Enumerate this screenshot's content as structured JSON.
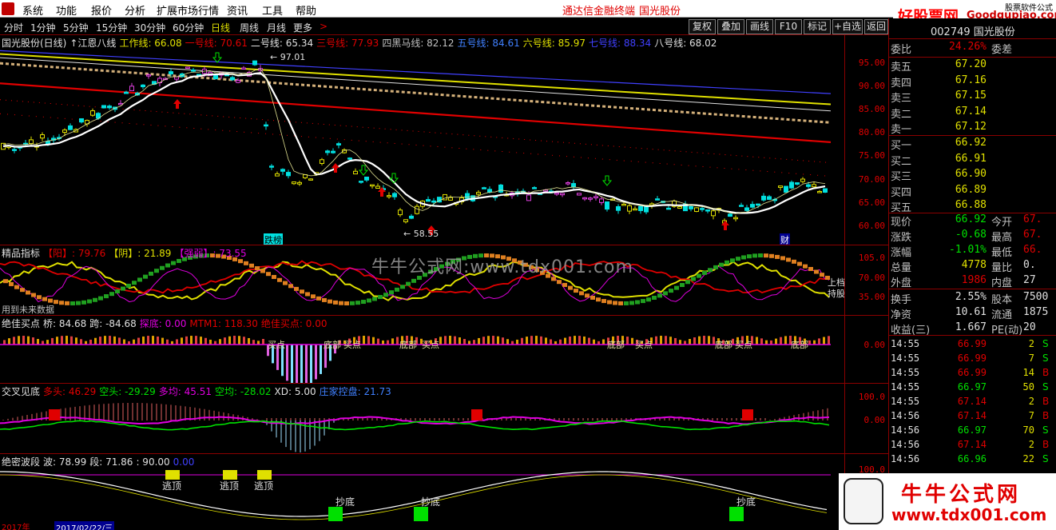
{
  "menu": {
    "items": [
      "系统",
      "功能",
      "报价",
      "分析",
      "扩展市场行情",
      "资讯",
      "工具",
      "帮助"
    ],
    "center_title": "通达信金融终端",
    "stock_title": "国光股份"
  },
  "site_badge": {
    "brand": "好股票网",
    "domain": "Goodgupiao.com",
    "caption": "股票软件公式"
  },
  "periods": {
    "items": [
      "分时",
      "1分钟",
      "5分钟",
      "15分钟",
      "30分钟",
      "60分钟",
      "日线",
      "周线",
      "月线",
      "更多",
      ">"
    ],
    "active": "日线"
  },
  "toolbar_right": [
    "复权",
    "叠加",
    "画线",
    "F10",
    "标记",
    "+自选",
    "返回"
  ],
  "main_chart": {
    "header": [
      {
        "text": "国光股份(日线)",
        "color": "#e0e0e0"
      },
      {
        "text": "↑江恩八线",
        "color": "#e0e0e0"
      },
      {
        "text": "工作线: 66.08",
        "color": "#e0e000"
      },
      {
        "text": "一号线: 70.61",
        "color": "#e00000"
      },
      {
        "text": "二号线: 65.34",
        "color": "#e0e0e0"
      },
      {
        "text": "三号线: 77.93",
        "color": "#e00000"
      },
      {
        "text": "四黑马线: 82.12",
        "color": "#c0c0c0"
      },
      {
        "text": "五号线: 84.61",
        "color": "#4080ff"
      },
      {
        "text": "六号线: 85.97",
        "color": "#e0e000"
      },
      {
        "text": "七号线: 88.34",
        "color": "#4040ff"
      },
      {
        "text": "八号线: 68.02",
        "color": "#e0e0e0"
      }
    ],
    "yticks": [
      "95.00",
      "90.00",
      "85.00",
      "80.00",
      "75.00",
      "70.00",
      "65.00",
      "60.00"
    ],
    "high_label": "97.01",
    "low_label": "58.55",
    "markers": [
      "跌榜",
      "财"
    ]
  },
  "panel_jingpin": {
    "header": [
      {
        "text": "精品指标",
        "color": "#e0e0e0"
      },
      {
        "text": "【阳】: 79.76",
        "color": "#e00000"
      },
      {
        "text": "【阴】: 21.89",
        "color": "#e0e000"
      },
      {
        "text": "【强弱】: 73.55",
        "color": "#e000e0"
      }
    ],
    "yticks": [
      "105.0",
      "70.00",
      "35.00"
    ],
    "note": "用到未来数据",
    "side_labels": [
      "上档",
      "持股"
    ]
  },
  "panel_juejia": {
    "header": [
      {
        "text": "绝佳买点",
        "color": "#e0e0e0"
      },
      {
        "text": "桥: 84.68",
        "color": "#e0e0e0"
      },
      {
        "text": "跨: -84.68",
        "color": "#e0e0e0"
      },
      {
        "text": "探底: 0.00",
        "color": "#e000e0"
      },
      {
        "text": "MTM1: 118.30",
        "color": "#e00000"
      },
      {
        "text": "绝佳买点: 0.00",
        "color": "#e00000"
      }
    ],
    "yticks": [
      "0.00"
    ],
    "labels": [
      "买点",
      "底部",
      "买点",
      "底部",
      "买点",
      "底部",
      "买点",
      "底部",
      "买点",
      "底部"
    ]
  },
  "panel_jiaocha": {
    "header": [
      {
        "text": "交叉见底",
        "color": "#e0e0e0"
      },
      {
        "text": "多头: 46.29",
        "color": "#e00000"
      },
      {
        "text": "空头: -29.29",
        "color": "#00e000"
      },
      {
        "text": "多均: 45.51",
        "color": "#e000e0"
      },
      {
        "text": "空均: -28.02",
        "color": "#00e000"
      },
      {
        "text": "XD: 5.00",
        "color": "#e0e0e0"
      },
      {
        "text": "庄家控盘: 21.73",
        "color": "#4080ff"
      }
    ],
    "yticks": [
      "100.0",
      "0.00"
    ]
  },
  "panel_jueimi": {
    "header": [
      {
        "text": "绝密波段",
        "color": "#e0e0e0"
      },
      {
        "text": "波: 78.99",
        "color": "#e0e0e0"
      },
      {
        "text": "段: 71.86",
        "color": "#e0e0e0"
      },
      {
        "text": ": 90.00",
        "color": "#e0e0e0"
      },
      {
        "text": "0.00",
        "color": "#4040ff"
      }
    ],
    "yticks": [
      "100.0"
    ],
    "labels_top": [
      "逃顶",
      "逃顶",
      "逃顶"
    ],
    "labels_bottom": [
      "抄底",
      "抄底",
      "抄底"
    ]
  },
  "bottom": {
    "year": "2017年",
    "date": "2017/02/22/三"
  },
  "quote": {
    "code": "002749 国光股份",
    "wei_bi": {
      "label": "委比",
      "value": "24.26%",
      "label2": "委差"
    },
    "asks": [
      {
        "label": "卖五",
        "price": "67.20"
      },
      {
        "label": "卖四",
        "price": "67.16"
      },
      {
        "label": "卖三",
        "price": "67.15"
      },
      {
        "label": "卖二",
        "price": "67.14"
      },
      {
        "label": "卖一",
        "price": "67.12"
      }
    ],
    "bids": [
      {
        "label": "买一",
        "price": "66.92"
      },
      {
        "label": "买二",
        "price": "66.91"
      },
      {
        "label": "买三",
        "price": "66.90"
      },
      {
        "label": "买四",
        "price": "66.89"
      },
      {
        "label": "买五",
        "price": "66.88"
      }
    ],
    "stats": [
      {
        "l1": "现价",
        "v1": "66.92",
        "c1": "#00e000",
        "l2": "今开",
        "v2": "67."
      },
      {
        "l1": "涨跌",
        "v1": "-0.68",
        "c1": "#00e000",
        "l2": "最高",
        "v2": "67."
      },
      {
        "l1": "涨幅",
        "v1": "-1.01%",
        "c1": "#00e000",
        "l2": "最低",
        "v2": "66."
      },
      {
        "l1": "总量",
        "v1": "4778",
        "c1": "#e0e000",
        "l2": "量比",
        "v2": "0."
      },
      {
        "l1": "外盘",
        "v1": "1986",
        "c1": "#e00000",
        "l2": "内盘",
        "v2": "27"
      },
      {
        "l1": "换手",
        "v1": "2.55%",
        "c1": "#e0e0e0",
        "l2": "股本",
        "v2": "7500"
      },
      {
        "l1": "净资",
        "v1": "10.61",
        "c1": "#e0e0e0",
        "l2": "流通",
        "v2": "1875"
      },
      {
        "l1": "收益(三)",
        "v1": "1.667",
        "c1": "#e0e0e0",
        "l2": "PE(动)",
        "v2": "20"
      }
    ],
    "ticks": [
      {
        "t": "14:55",
        "p": "66.99",
        "v": "2",
        "d": "S"
      },
      {
        "t": "14:55",
        "p": "66.99",
        "v": "7",
        "d": "S"
      },
      {
        "t": "14:55",
        "p": "66.99",
        "v": "14",
        "d": "B"
      },
      {
        "t": "14:55",
        "p": "66.97",
        "v": "50",
        "d": "S"
      },
      {
        "t": "14:55",
        "p": "67.14",
        "v": "2",
        "d": "B"
      },
      {
        "t": "14:56",
        "p": "67.14",
        "v": "7",
        "d": "B"
      },
      {
        "t": "14:56",
        "p": "66.97",
        "v": "70",
        "d": "S"
      },
      {
        "t": "14:56",
        "p": "67.14",
        "v": "2",
        "d": "B"
      },
      {
        "t": "14:56",
        "p": "66.96",
        "v": "22",
        "d": "S"
      }
    ]
  },
  "watermarks": {
    "center": "牛牛公式网:www.tdx001.com",
    "corner_name": "牛牛公式网",
    "corner_url": "www.tdx001.com"
  },
  "colors": {
    "up": "#e00000",
    "down": "#00e0e0",
    "grid": "#8b0000",
    "accent": "#e0e000"
  }
}
